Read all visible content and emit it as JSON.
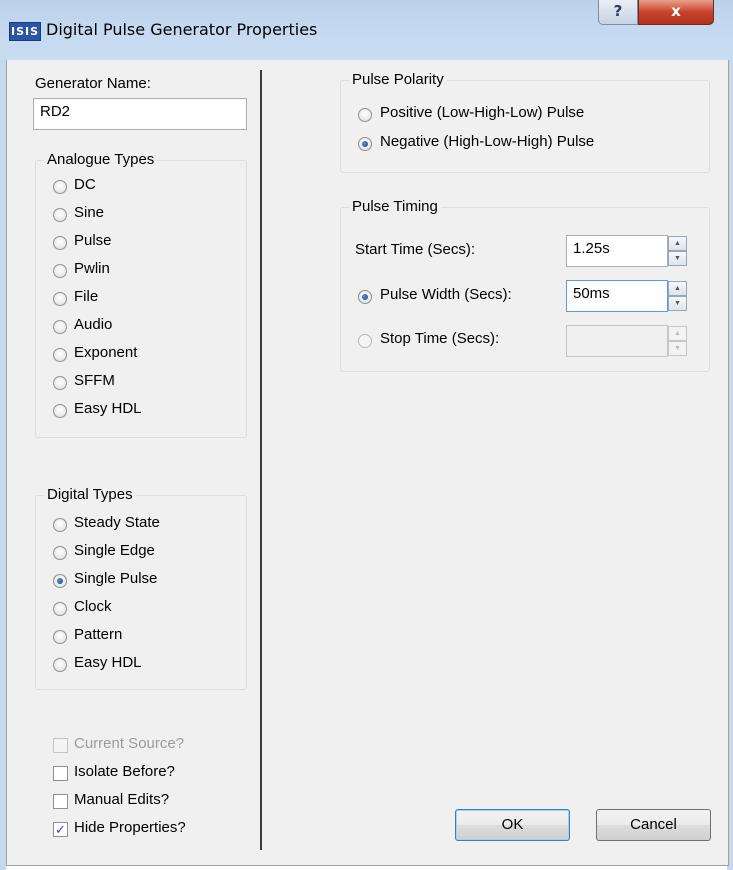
{
  "window": {
    "title": "Digital Pulse Generator Properties",
    "app_icon_text": "ISIS",
    "help_glyph": "?",
    "close_glyph": "x"
  },
  "generator_name": {
    "label": "Generator Name:",
    "value": "RD2"
  },
  "analogue_types": {
    "title": "Analogue Types",
    "options": [
      "DC",
      "Sine",
      "Pulse",
      "Pwlin",
      "File",
      "Audio",
      "Exponent",
      "SFFM",
      "Easy HDL"
    ]
  },
  "digital_types": {
    "title": "Digital Types",
    "options": [
      "Steady State",
      "Single Edge",
      "Single Pulse",
      "Clock",
      "Pattern",
      "Easy HDL"
    ],
    "selected": "Single Pulse"
  },
  "checkboxes": {
    "current_source": {
      "label": "Current Source?",
      "checked": false,
      "disabled": true
    },
    "isolate_before": {
      "label": "Isolate Before?",
      "checked": false
    },
    "manual_edits": {
      "label": "Manual Edits?",
      "checked": false
    },
    "hide_properties": {
      "label": "Hide Properties?",
      "checked": true,
      "mark": "✓"
    }
  },
  "pulse_polarity": {
    "title": "Pulse Polarity",
    "positive": "Positive (Low-High-Low) Pulse",
    "negative": "Negative (High-Low-High) Pulse",
    "selected": "negative"
  },
  "pulse_timing": {
    "title": "Pulse Timing",
    "start_time": {
      "label": "Start Time (Secs):",
      "value": "1.25s"
    },
    "pulse_width": {
      "label": "Pulse Width (Secs):",
      "value": "50ms",
      "selected": true
    },
    "stop_time": {
      "label": "Stop Time (Secs):",
      "value": "",
      "disabled": true
    }
  },
  "buttons": {
    "ok": "OK",
    "cancel": "Cancel"
  },
  "colors": {
    "title_bar": "#c4d9f0",
    "close_button": "#c8432b",
    "dialog_bg": "#f0f0f0",
    "radio_dot": "#15428b"
  },
  "icons": {
    "help": "question-mark",
    "close": "x-close",
    "spin_up": "up-arrow",
    "spin_down": "down-arrow"
  }
}
